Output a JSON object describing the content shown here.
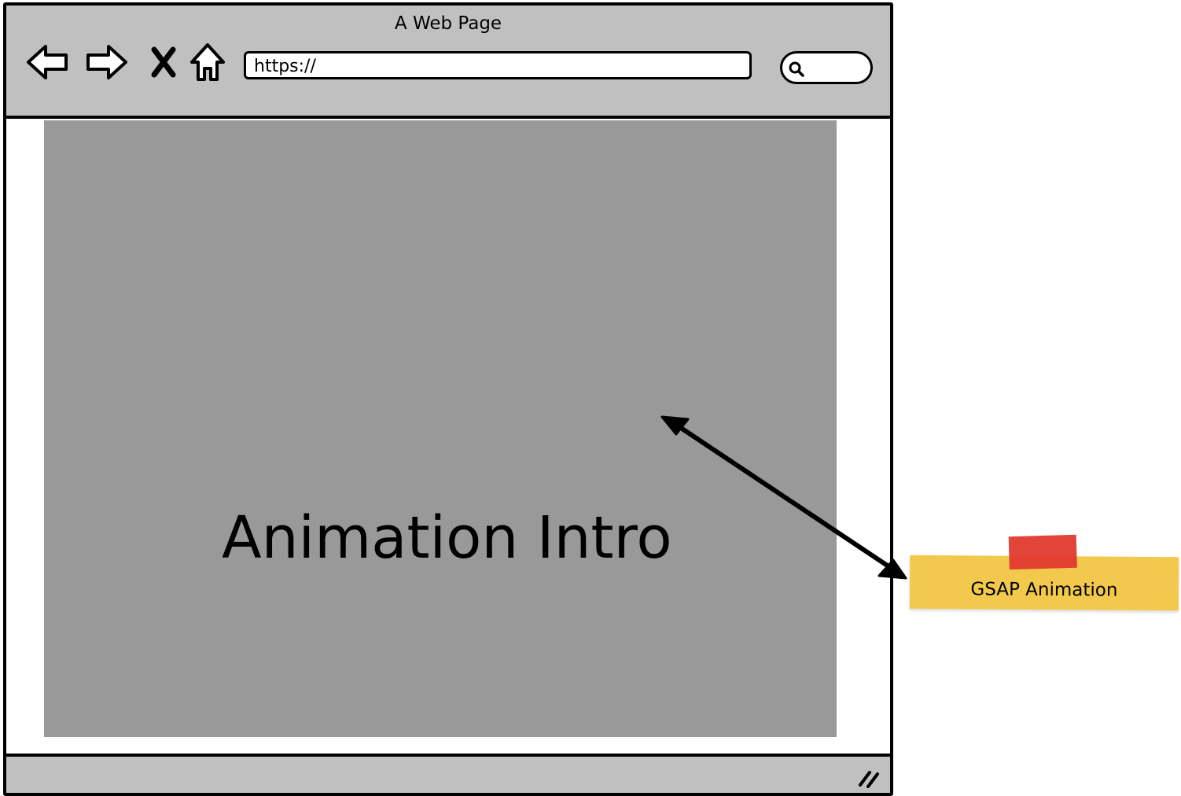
{
  "window": {
    "title": "A Web Page"
  },
  "toolbar": {
    "back_icon": "arrow-left-icon",
    "forward_icon": "arrow-right-icon",
    "stop_icon": "close-icon",
    "home_icon": "home-icon",
    "url_value": "https://",
    "search_icon": "search-icon"
  },
  "content": {
    "hero_text": "Animation Intro",
    "background_color": "#999999"
  },
  "annotation": {
    "note_text": "GSAP Animation",
    "note_color": "#f2c94c",
    "tape_color": "#e03a2f"
  },
  "colors": {
    "chrome": "#c0c0c0",
    "stroke": "#000000"
  }
}
